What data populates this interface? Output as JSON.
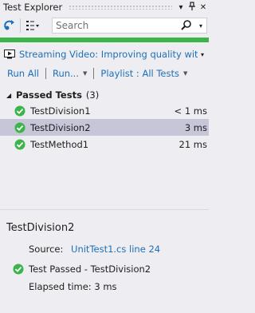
{
  "window": {
    "title": "Test Explorer",
    "pin_icon": "pin-icon",
    "close_icon": "close-icon",
    "dropdown_icon": "window-menu-icon"
  },
  "toolbar": {
    "run_icon": "run-all-icon",
    "group_icon": "group-by-icon",
    "search": {
      "placeholder": "Search",
      "value": ""
    }
  },
  "progress": {
    "fraction": 1.0,
    "color": "#3bb44a"
  },
  "playlist_bar": {
    "label": "Streaming Video: Improving quality with u"
  },
  "commands": {
    "run_all": "Run All",
    "run": "Run...",
    "playlist": "Playlist : All Tests"
  },
  "group": {
    "title": "Passed Tests",
    "count": "(3)"
  },
  "tests": [
    {
      "name": "TestDivision1",
      "duration": "< 1 ms",
      "selected": false
    },
    {
      "name": "TestDivision2",
      "duration": "3 ms",
      "selected": true
    },
    {
      "name": "TestMethod1",
      "duration": "21 ms",
      "selected": false
    }
  ],
  "details": {
    "title": "TestDivision2",
    "source_label": "Source:",
    "source_link": "UnitTest1.cs line 24",
    "status": "Test Passed - TestDivision2",
    "elapsed": "Elapsed time: 3 ms"
  },
  "colors": {
    "accent_link": "#1e6fb6",
    "pass_green": "#3bb44a",
    "selection": "#c6c6d8",
    "background": "#eeeef2"
  }
}
